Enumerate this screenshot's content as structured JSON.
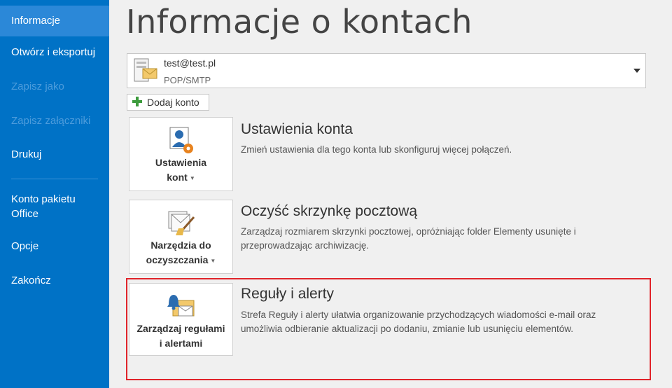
{
  "sidebar": {
    "items": [
      {
        "label": "Informacje",
        "state": "active"
      },
      {
        "label": "Otwórz i eksportuj",
        "state": "normal"
      },
      {
        "label": "Zapisz jako",
        "state": "disabled"
      },
      {
        "label": "Zapisz załączniki",
        "state": "disabled"
      },
      {
        "label": "Drukuj",
        "state": "normal"
      },
      {
        "label": "Konto pakietu\nOffice",
        "state": "normal"
      },
      {
        "label": "Opcje",
        "state": "normal"
      },
      {
        "label": "Zakończ",
        "state": "normal"
      }
    ]
  },
  "main": {
    "title": "Informacje o kontach",
    "account": {
      "email": "test@test.pl",
      "type": "POP/SMTP"
    },
    "add_account_label": "Dodaj konto",
    "sections": [
      {
        "tile_label_line1": "Ustawienia",
        "tile_label_line2": "kont",
        "has_dropdown": true,
        "title": "Ustawienia konta",
        "description": "Zmień ustawienia dla tego konta lub skonfiguruj więcej połączeń.",
        "icon": "account-settings-icon"
      },
      {
        "tile_label_line1": "Narzędzia do",
        "tile_label_line2": "oczyszczania",
        "has_dropdown": true,
        "title": "Oczyść skrzynkę pocztową",
        "description": "Zarządzaj rozmiarem skrzynki pocztowej, opróżniając folder Elementy usunięte i przeprowadzając archiwizację.",
        "icon": "cleanup-tools-icon"
      },
      {
        "tile_label_line1": "Zarządzaj regułami",
        "tile_label_line2": "i alertami",
        "has_dropdown": false,
        "title": "Reguły i alerty",
        "description": "Strefa Reguły i alerty ułatwia organizowanie przychodzących wiadomości e-mail oraz umożliwia odbieranie aktualizacji po dodaniu, zmianie lub usunięciu elementów.",
        "icon": "rules-alerts-icon"
      }
    ]
  },
  "colors": {
    "sidebar": "#0072c6",
    "sidebar_active": "#2b88d8",
    "highlight": "#e0242b"
  }
}
